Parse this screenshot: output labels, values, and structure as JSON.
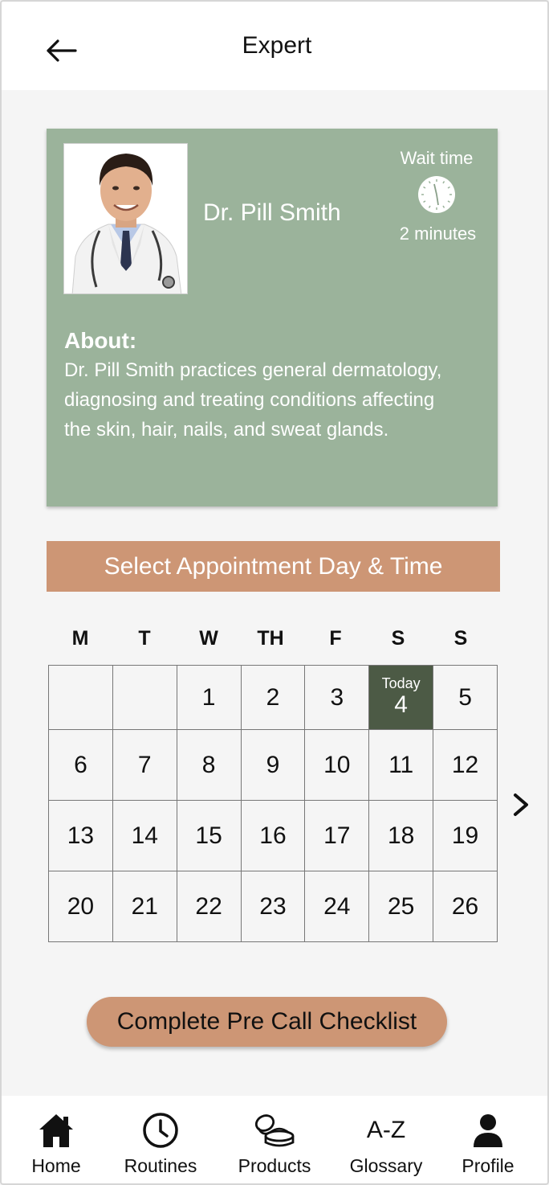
{
  "header": {
    "title": "Expert"
  },
  "doctor": {
    "name": "Dr. Pill Smith",
    "wait_label": "Wait time",
    "wait_value": "2 minutes",
    "about_heading": "About:",
    "about_text": "Dr. Pill Smith practices general dermatology, diagnosing and treating conditions affecting the skin, hair, nails, and sweat glands."
  },
  "booking": {
    "title": "Select Appointment Day & Time",
    "weekdays": [
      "M",
      "T",
      "W",
      "TH",
      "F",
      "S",
      "S"
    ],
    "weeks": [
      [
        "",
        "",
        "1",
        "2",
        "3",
        "4",
        "5"
      ],
      [
        "6",
        "7",
        "8",
        "9",
        "10",
        "11",
        "12"
      ],
      [
        "13",
        "14",
        "15",
        "16",
        "17",
        "18",
        "19"
      ],
      [
        "20",
        "21",
        "22",
        "23",
        "24",
        "25",
        "26"
      ]
    ],
    "today_label": "Today",
    "today_day": "4"
  },
  "checklist_button": "Complete Pre Call Checklist",
  "nav": {
    "items": [
      {
        "label": "Home",
        "icon": "home-icon"
      },
      {
        "label": "Routines",
        "icon": "clock-icon"
      },
      {
        "label": "Products",
        "icon": "products-icon"
      },
      {
        "label": "Glossary",
        "icon": "a-z-icon",
        "icon_text": "A-Z"
      },
      {
        "label": "Profile",
        "icon": "profile-icon"
      }
    ]
  },
  "colors": {
    "card": "#9bb39b",
    "accent": "#cd9675",
    "today": "#4c5a45"
  }
}
